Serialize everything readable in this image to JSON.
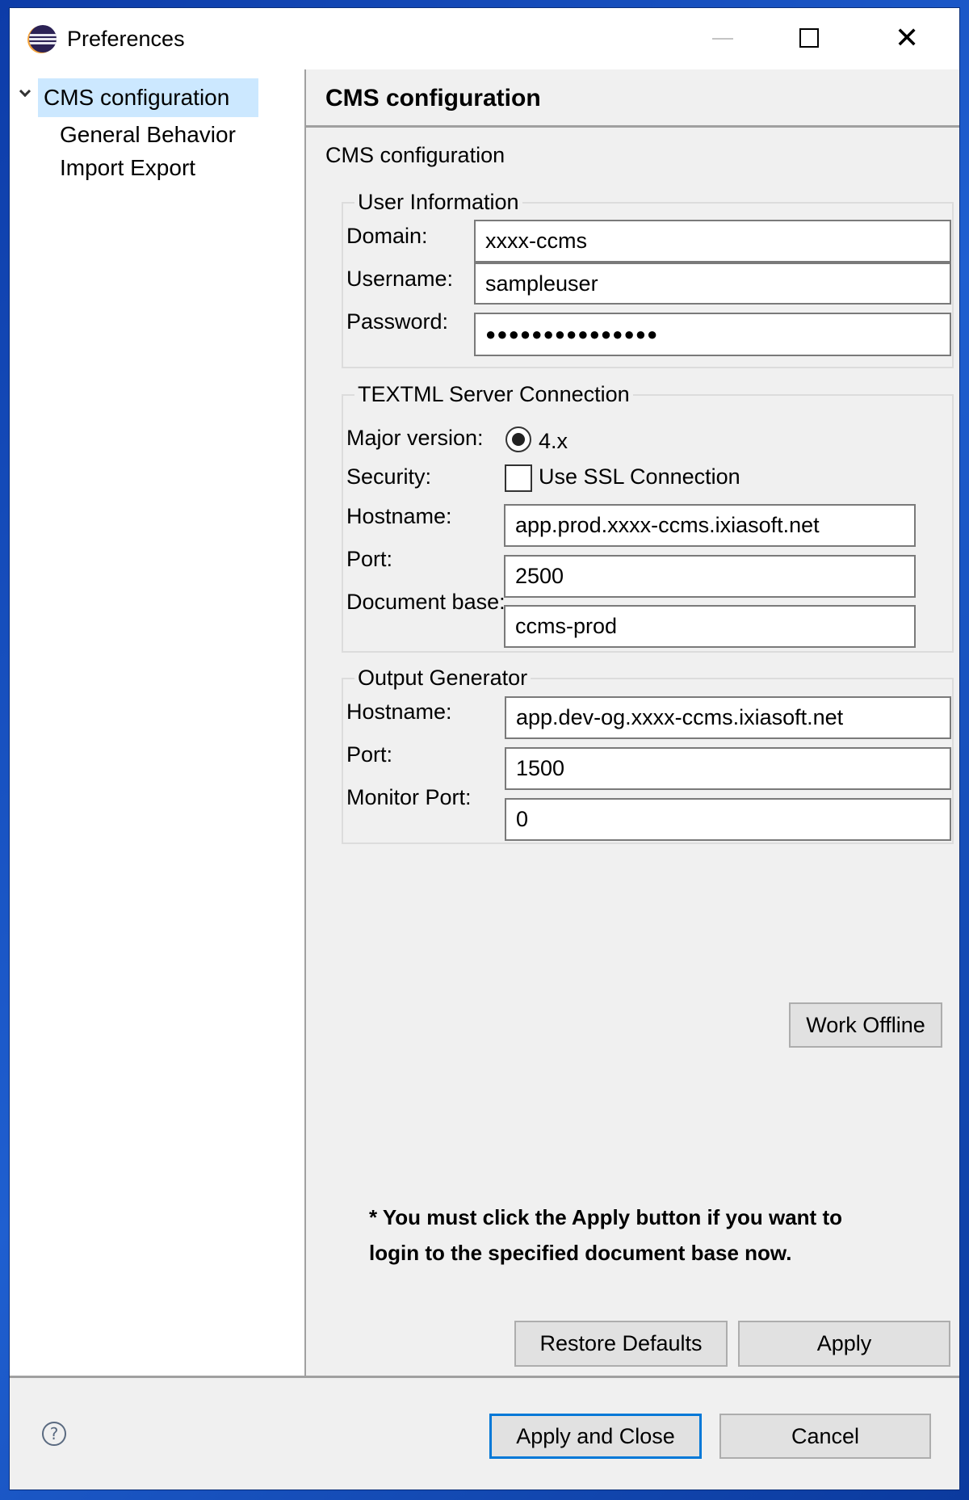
{
  "window": {
    "title": "Preferences",
    "icon": "eclipse-app-icon",
    "controls": {
      "minimize": "minimize-icon",
      "maximize": "maximize-icon",
      "close": "close-icon",
      "close_glyph": "✕"
    }
  },
  "sidebar": {
    "items": [
      {
        "label": "CMS configuration",
        "expanded": true,
        "selected": true,
        "level": 0
      },
      {
        "label": "General Behavior",
        "selected": false,
        "level": 1
      },
      {
        "label": "Import Export",
        "selected": false,
        "level": 1
      }
    ]
  },
  "page": {
    "title": "CMS configuration",
    "description": "CMS configuration"
  },
  "user_information": {
    "title": "User Information",
    "domain": {
      "label": "Domain:",
      "value": "xxxx-ccms"
    },
    "username": {
      "label": "Username:",
      "value": "sampleuser"
    },
    "password": {
      "label": "Password:",
      "value": "●●●●●●●●●●●●●●●",
      "masked_length": 15
    }
  },
  "textml": {
    "title": "TEXTML Server Connection",
    "major_version": {
      "label": "Major version:",
      "option": "4.x",
      "selected": true
    },
    "security": {
      "label": "Security:",
      "option": "Use SSL Connection",
      "checked": false
    },
    "hostname": {
      "label": "Hostname:",
      "value": "app.prod.xxxx-ccms.ixiasoft.net"
    },
    "port": {
      "label": "Port:",
      "value": "2500"
    },
    "document_base": {
      "label": "Document base:",
      "value": "ccms-prod"
    }
  },
  "output_generator": {
    "title": "Output Generator",
    "hostname": {
      "label": "Hostname:",
      "value": "app.dev-og.xxxx-ccms.ixiasoft.net"
    },
    "port": {
      "label": "Port:",
      "value": "1500"
    },
    "monitor_port": {
      "label": "Monitor Port:",
      "value": "0"
    }
  },
  "buttons": {
    "work_offline": "Work Offline",
    "restore_defaults": "Restore Defaults",
    "apply": "Apply",
    "apply_and_close": "Apply and Close",
    "cancel": "Cancel"
  },
  "note": {
    "line1": "* You must click the Apply button if you want to",
    "line2": "login to the specified document base now."
  },
  "footer": {
    "help_glyph": "?"
  },
  "colors": {
    "selection": "#cce8ff",
    "default_button_border": "#0078d7",
    "desktop": "#1a4fb8"
  }
}
